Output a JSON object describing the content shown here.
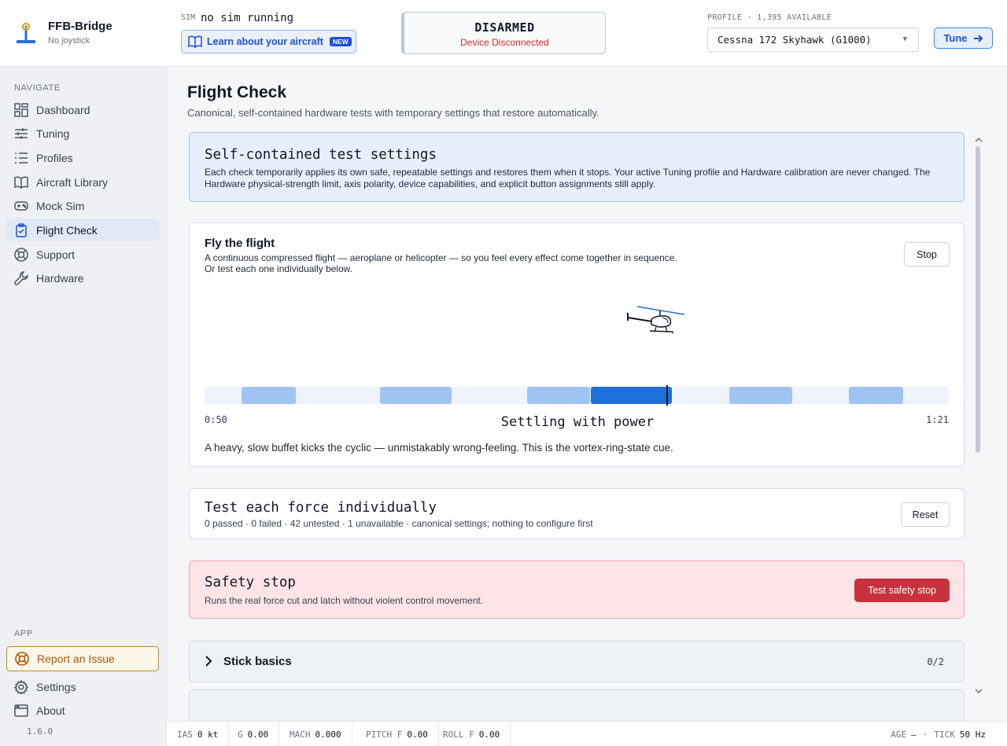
{
  "app": {
    "name": "FFB-Bridge",
    "device": "No joystick",
    "version": "1.6.0"
  },
  "sidebar": {
    "navigate_heading": "NAVIGATE",
    "items": [
      {
        "label": "Dashboard",
        "icon": "dashboard-icon"
      },
      {
        "label": "Tuning",
        "icon": "sliders-icon"
      },
      {
        "label": "Profiles",
        "icon": "list-icon"
      },
      {
        "label": "Aircraft Library",
        "icon": "book-icon"
      },
      {
        "label": "Mock Sim",
        "icon": "gamepad-icon"
      },
      {
        "label": "Flight Check",
        "icon": "clipboard-check-icon",
        "active": true
      },
      {
        "label": "Support",
        "icon": "lifebuoy-icon"
      },
      {
        "label": "Hardware",
        "icon": "wrench-icon"
      }
    ],
    "app_heading": "APP",
    "report_label": "Report an Issue",
    "app_items": [
      {
        "label": "Settings",
        "icon": "gear-icon"
      },
      {
        "label": "About",
        "icon": "window-icon"
      }
    ]
  },
  "topbar": {
    "sim_label": "SIM",
    "sim_value": "no sim running",
    "learn_label": "Learn about your aircraft",
    "learn_badge": "NEW",
    "status_title": "DISARMED",
    "status_sub": "Device Disconnected",
    "profile_label": "PROFILE · 1,395 AVAILABLE",
    "profile_value": "Cessna 172 Skyhawk (G1000)",
    "tune_label": "Tune"
  },
  "page": {
    "title": "Flight Check",
    "subtitle": "Canonical, self-contained hardware tests with temporary settings that restore automatically."
  },
  "info": {
    "title": "Self-contained test settings",
    "body": "Each check temporarily applies its own safe, repeatable settings and restores them when it stops. Your active Tuning profile and Hardware calibration are never changed. The Hardware physical-strength limit, axis polarity, device capabilities, and explicit button assignments still apply."
  },
  "fly": {
    "title": "Fly the flight",
    "line1": "A continuous compressed flight — aeroplane or helicopter — so you feel every effect come together in sequence.",
    "line2": "Or test each one individually below.",
    "stop_label": "Stop",
    "time_start": "0:50",
    "time_end": "1:21",
    "phase": "Settling with power",
    "description": "A heavy, slow buffet kicks the cyclic — unmistakably wrong-feeling. This is the vortex-ring-state cue.",
    "progress": 0.62
  },
  "tests": {
    "title": "Test each force individually",
    "summary": "0 passed · 0 failed · 42 untested · 1 unavailable · canonical settings; nothing to configure first",
    "reset_label": "Reset"
  },
  "safety": {
    "title": "Safety stop",
    "body": "Runs the real force cut and latch without violent control movement.",
    "button_label": "Test safety stop"
  },
  "sections": [
    {
      "title": "Stick basics",
      "count": "0/2"
    }
  ],
  "statusbar": {
    "ias_label": "IAS",
    "ias_value": "0 kt",
    "g_label": "G",
    "g_value": "0.00",
    "mach_label": "MACH",
    "mach_value": "0.000",
    "pitchf_label": "PITCH F",
    "pitchf_value": "0.00",
    "rollf_label": "ROLL F",
    "rollf_value": "0.00",
    "age_label": "AGE",
    "age_value": "—",
    "sep": "·",
    "tick_label": "TICK",
    "tick_value": "50 Hz"
  },
  "colors": {
    "accent": "#1d4ed8",
    "danger": "#c8323d",
    "warning": "#b45309",
    "segment": "#a0c4f2",
    "segment_active": "#1e6fd9"
  }
}
